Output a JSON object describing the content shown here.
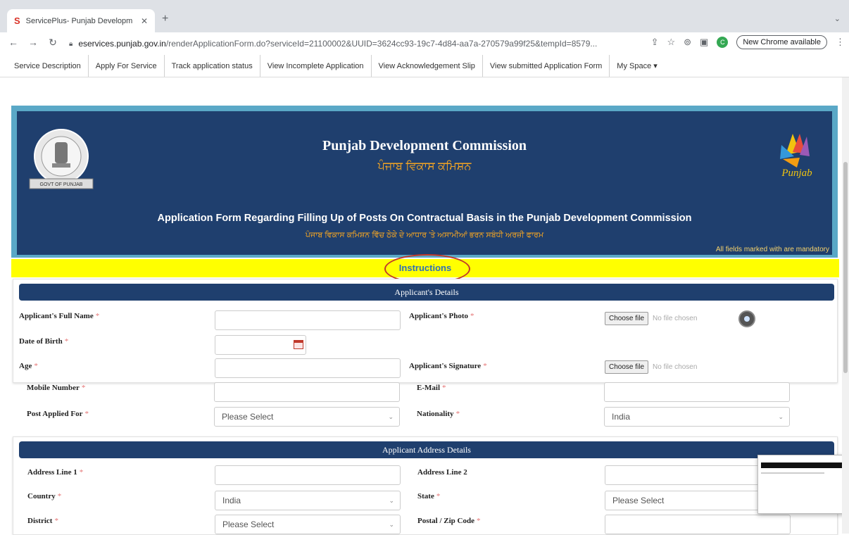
{
  "browser": {
    "tab_title": "ServicePlus- Punjab Developm",
    "tab_close": "✕",
    "new_tab": "+",
    "tab_menu": "⌄",
    "url_host": "eservices.punjab.gov.in",
    "url_path": "/renderApplicationForm.do?serviceId=21100002&UUID=3624cc93-19c7-4d84-aa7a-270579a99f25&tempId=8579...",
    "profile_initial": "C",
    "new_chrome": "New Chrome available",
    "icons": [
      "back-icon",
      "forward-icon",
      "reload-icon",
      "lock-icon",
      "share-icon",
      "star-icon",
      "extensions-icon",
      "sidepanel-icon",
      "menu-icon"
    ]
  },
  "service_nav": [
    "Service Description",
    "Apply For Service",
    "Track application status",
    "View Incomplete Application",
    "View Acknowledgement Slip",
    "View submitted Application Form",
    "My Space ▾"
  ],
  "banner": {
    "title": "Punjab Development Commission",
    "title_pa": "ਪੰਜਾਬ ਵਿਕਾਸ ਕਮਿਸ਼ਨ",
    "form_title": "Application Form Regarding Filling Up of Posts On Contractual Basis in the Punjab Development Commission",
    "form_title_pa": "ਪੰਜਾਬ ਵਿਕਾਸ ਕਮਿਸ਼ਨ ਵਿੱਚ ਠੇਕੇ ਦੇ ਆਧਾਰ 'ਤੇ ਅਸਾਮੀਆਂ ਭਰਨ ਸਬੰਧੀ ਅਰਜ਼ੀ ਫਾਰਮ",
    "mandatory_note": "All fields marked with   are mandatory",
    "emblem_text": "GOVT OF PUNJAB",
    "logo_text": "Punjab"
  },
  "instructions": "Instructions",
  "applicant": {
    "header": "Applicant's Details",
    "full_name": "Applicant's Full Name",
    "dob": "Date of Birth",
    "age": "Age",
    "mobile": "Mobile Number",
    "post": "Post Applied For",
    "post_value": "Please Select",
    "photo": "Applicant's Photo",
    "signature": "Applicant's Signature",
    "email": "E-Mail",
    "nationality": "Nationality",
    "nationality_value": "India",
    "choose_file": "Choose file",
    "no_file": "No file chosen",
    "req": "*"
  },
  "address": {
    "header": "Applicant Address Details",
    "line1": "Address Line 1",
    "line2": "Address Line 2",
    "country": "Country",
    "country_value": "India",
    "state": "State",
    "state_value": "Please Select",
    "district": "District",
    "district_value": "Please Select",
    "postal": "Postal / Zip Code"
  }
}
